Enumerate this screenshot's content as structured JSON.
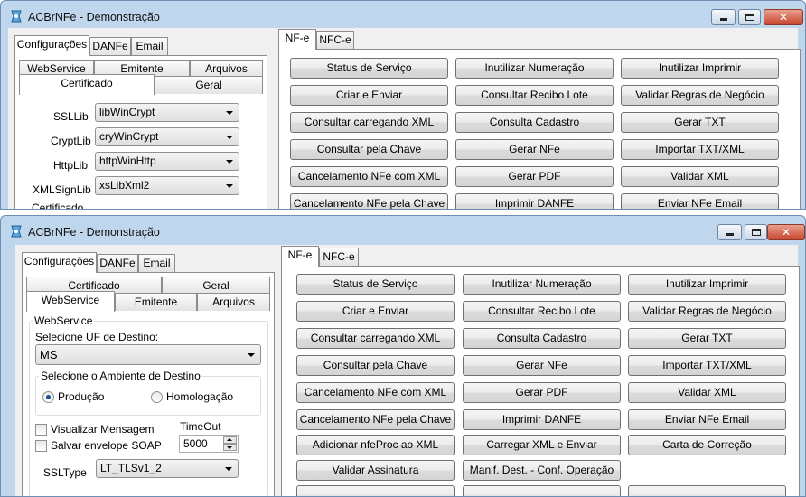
{
  "window": {
    "title": "ACBrNFe - Demonstração",
    "minimize_glyph": "_",
    "maximize_glyph": "□",
    "close_glyph": "✕",
    "icon": "acbr-app-icon"
  },
  "colors": {
    "frame": "#bfd6ec",
    "close_button": "#c8462e",
    "radio_dot": "#1f4f99"
  },
  "left_tabs": [
    "Configurações",
    "DANFe",
    "Email"
  ],
  "config_tabs": [
    "WebService",
    "Emitente",
    "Arquivos",
    "Certificado",
    "Geral"
  ],
  "right_tabs": [
    "NF-e",
    "NFC-e"
  ],
  "certificado": {
    "ssllib_label": "SSLLib",
    "ssllib_value": "libWinCrypt",
    "cryptlib_label": "CryptLib",
    "cryptlib_value": "cryWinCrypt",
    "httplib_label": "HttpLib",
    "httplib_value": "httpWinHttp",
    "xmlsignlib_label": "XMLSignLib",
    "xmlsignlib_value": "xsLibXml2",
    "partial_label": "Certificado"
  },
  "webservice": {
    "group_title": "WebService",
    "uf_label": "Selecione UF de Destino:",
    "uf_value": "MS",
    "ambiente_title": "Selecione o Ambiente de Destino",
    "producao_label": "Produção",
    "homologacao_label": "Homologação",
    "visualizar_label": "Visualizar Mensagem",
    "salvar_label": "Salvar envelope SOAP",
    "timeout_label": "TimeOut",
    "timeout_value": "5000",
    "ssltype_label": "SSLType",
    "ssltype_value": "LT_TLSv1_2"
  },
  "buttons": [
    "Status de Serviço",
    "Inutilizar Numeração",
    "Inutilizar Imprimir",
    "Criar e Enviar",
    "Consultar Recibo Lote",
    "Validar Regras de Negócio",
    "Consultar carregando XML",
    "Consulta Cadastro",
    "Gerar TXT",
    "Consultar pela Chave",
    "Gerar NFe",
    "Importar TXT/XML",
    "Cancelamento NFe com XML",
    "Gerar PDF",
    "Validar XML",
    "Cancelamento NFe pela Chave",
    "Imprimir DANFE",
    "Enviar NFe Email",
    "Adicionar nfeProc ao XML",
    "Carregar XML e Enviar",
    "Carta de Correção",
    "Validar Assinatura",
    "Manif. Dest. - Conf. Operação"
  ]
}
